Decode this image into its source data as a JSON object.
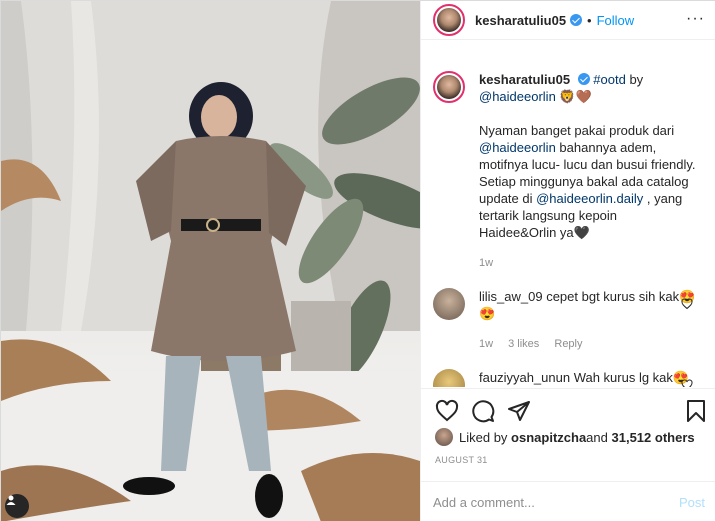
{
  "header": {
    "username": "kesharatuliu05",
    "separator": "•",
    "follow_label": "Follow",
    "more_icon": "ellipsis-icon"
  },
  "caption": {
    "username": "kesharatuliu05",
    "hashtag": "#ootd",
    "by_text": " by",
    "mention": "@haideeorlin",
    "emoji": " 🦁🤎",
    "p1_a": "Nyaman banget pakai produk dari ",
    "p1_mention": "@haideeorlin",
    "p1_b": " bahannya adem, motifnya lucu- lucu dan busui friendly. Setiap minggunya bakal ada catalog update di ",
    "p1_mention2": "@haideeorlin.daily",
    "p1_c": " , yang tertarik langsung kepoin Haidee&Orlin ya🖤",
    "time": "1w"
  },
  "comments": [
    {
      "username": "lilis_aw_09",
      "text": " cepet bgt kurus sih kak😍😍",
      "time": "1w",
      "likes": "3 likes",
      "reply": "Reply"
    },
    {
      "username": "fauziyyah_unun",
      "text": " Wah kurus lg kak😍😍"
    }
  ],
  "likes": {
    "prefix": "Liked by ",
    "user": "osnapitzcha",
    "middle": " and ",
    "count": "31,512 others"
  },
  "date": "AUGUST 31",
  "add_comment": {
    "placeholder": "Add a comment...",
    "post_label": "Post"
  },
  "colors": {
    "accent": "#0095f6",
    "verified": "#3897f0",
    "mention": "#00376b",
    "muted": "#8e8e8e"
  }
}
